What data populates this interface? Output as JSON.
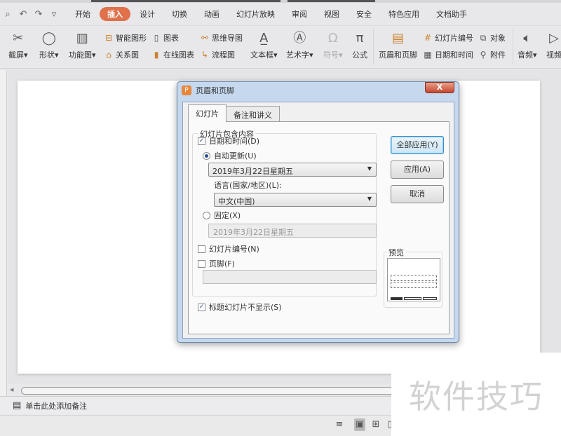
{
  "quick_access": {
    "icons": [
      "preview-icon",
      "undo-icon",
      "redo-icon",
      "customize-icon"
    ]
  },
  "menu": {
    "items": [
      "开始",
      "插入",
      "设计",
      "切换",
      "动画",
      "幻灯片放映",
      "审阅",
      "视图",
      "安全",
      "特色应用",
      "文档助手"
    ],
    "active": "插入",
    "active_color": "#e0714a"
  },
  "ribbon": {
    "screenshot": "截屏",
    "shapes": "形状",
    "function_chart": "功能图",
    "smartart": "智能图形",
    "relation": "关系图",
    "chart": "图表",
    "online_chart": "在线图表",
    "mindmap": "思维导图",
    "flowchart": "流程图",
    "textbox": "文本框",
    "wordart": "艺术字",
    "symbol": "符号",
    "formula": "公式",
    "header_footer": "页眉和页脚",
    "slide_number": "幻灯片编号",
    "date_time": "日期和时间",
    "object": "对象",
    "attachment": "附件",
    "audio": "音频",
    "video": "视频"
  },
  "notes": {
    "placeholder": "单击此处添加备注"
  },
  "watermark": "软件技巧",
  "dialog": {
    "title": "页眉和页脚",
    "close": "X",
    "tabs": [
      "幻灯片",
      "备注和讲义"
    ],
    "active_tab": "幻灯片",
    "group_label": "幻灯片包含内容",
    "date_time": {
      "label": "日期和时间(D)",
      "checked": true
    },
    "auto_update": {
      "label": "自动更新(U)",
      "selected": true,
      "value": "2019年3月22日星期五"
    },
    "language": {
      "label": "语言(国家/地区)(L):",
      "value": "中文(中国)"
    },
    "fixed": {
      "label": "固定(X)",
      "selected": false,
      "value": "2019年3月22日星期五"
    },
    "slide_number": {
      "label": "幻灯片编号(N)",
      "checked": false
    },
    "footer": {
      "label": "页脚(F)",
      "checked": false,
      "value": ""
    },
    "hide_title": {
      "label": "标题幻灯片不显示(S)",
      "checked": true
    },
    "buttons": {
      "apply_all": "全部应用(Y)",
      "apply": "应用(A)",
      "cancel": "取消"
    },
    "preview_label": "预览"
  }
}
